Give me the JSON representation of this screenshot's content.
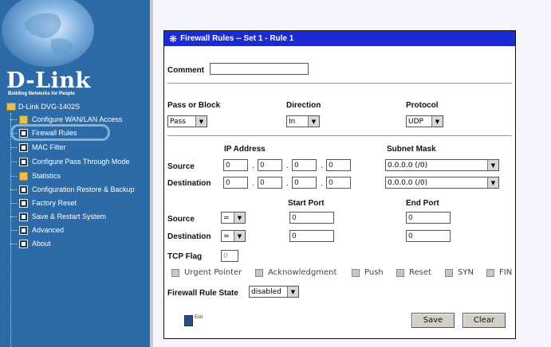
{
  "sidebar": {
    "brand": "D-Link",
    "tagline": "Building Networks for People",
    "root": "D-Link DVG-1402S",
    "items": [
      {
        "label": "Configure WAN/LAN Access",
        "icon": "folder-icon"
      },
      {
        "label": "Firewall Rules",
        "icon": "page-icon"
      },
      {
        "label": "MAC Filter",
        "icon": "page-icon"
      },
      {
        "label": "Configure Pass Through Mode",
        "icon": "page-icon"
      },
      {
        "label": "Statistics",
        "icon": "folder-icon"
      },
      {
        "label": "Configuration Restore & Backup",
        "icon": "page-icon"
      },
      {
        "label": "Factory Reset",
        "icon": "page-icon"
      },
      {
        "label": "Save & Restart System",
        "icon": "page-icon"
      },
      {
        "label": "Advanced",
        "icon": "page-icon"
      },
      {
        "label": "About",
        "icon": "page-icon"
      }
    ]
  },
  "panel": {
    "title": "Firewall Rules -- Set 1 - Rule 1",
    "comment_label": "Comment",
    "comment_value": "",
    "pass_label": "Pass or Block",
    "pass_value": "Pass",
    "direction_label": "Direction",
    "direction_value": "In",
    "protocol_label": "Protocol",
    "protocol_value": "UDP",
    "ip_header": "IP Address",
    "mask_header": "Subnet Mask",
    "source_label": "Source",
    "destination_label": "Destination",
    "source_ip": [
      "0",
      "0",
      "0",
      "0"
    ],
    "dest_ip": [
      "0",
      "0",
      "0",
      "0"
    ],
    "source_mask": "0.0.0.0 (/0)",
    "dest_mask": "0.0.0.0 (/0)",
    "ip_dot": ".",
    "start_port_header": "Start Port",
    "end_port_header": "End Port",
    "port_source_label": "Source",
    "port_dest_label": "Destination",
    "source_port_op": "=",
    "dest_port_op": "=",
    "source_start_port": "0",
    "source_end_port": "0",
    "dest_start_port": "0",
    "dest_end_port": "0",
    "tcp_flag_label": "TCP Flag",
    "tcp_flag_value": "0",
    "flags": [
      "Urgent Pointer",
      "Acknowledgment",
      "Push",
      "Reset",
      "SYN",
      "FIN"
    ],
    "state_label": "Firewall Rule State",
    "state_value": "disabled",
    "exit_label": "Exit",
    "save_label": "Save",
    "clear_label": "Clear"
  },
  "colors": {
    "sidebar_bg": "#2d6aa8",
    "titlebar_bg": "#1a2bd6",
    "highlight": "#7fb3dd"
  }
}
